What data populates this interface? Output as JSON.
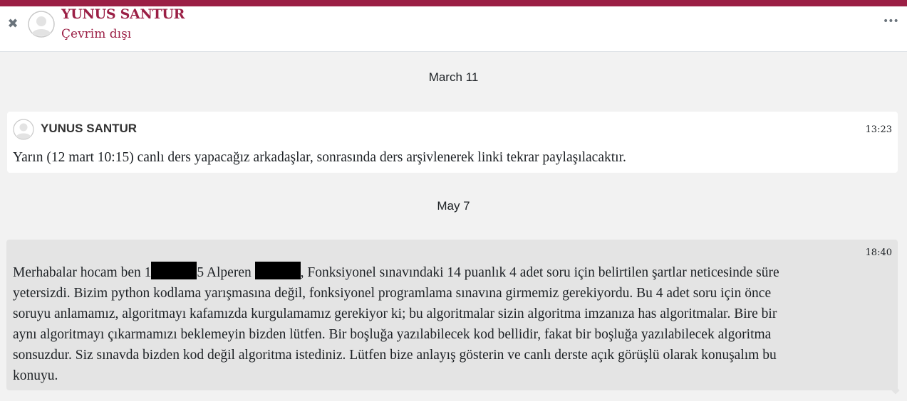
{
  "header": {
    "close_icon": "close-icon",
    "contact_name": "YUNUS SANTUR",
    "status": "Çevrim dışı",
    "menu_icon": "more-horizontal-icon",
    "accent_color": "#9b1f45"
  },
  "conversation": {
    "dates": [
      "March 11",
      "May 7"
    ],
    "messages": [
      {
        "sender": "YUNUS SANTUR",
        "time": "13:23",
        "text": "Yarın (12 mart 10:15) canlı ders yapacağız arkadaşlar, sonrasında ders arşivlenerek linki tekrar paylaşılacaktır."
      },
      {
        "time": "18:40",
        "line1_a": "Merhabalar hocam ben 1",
        "line1_b": "5 Alperen ",
        "line1_c": ", Fonksiyonel sınavındaki 14 puanlık 4 adet soru için belirtilen şartlar neticesinde süre",
        "lines": [
          "yetersizdi. Bizim python kodlama yarışmasına değil, fonksiyonel programlama sınavına girmemiz gerekiyordu. Bu 4 adet soru için önce",
          "soruyu anlamamız, algoritmayı kafamızda kurgulamamız gerekiyor ki; bu algoritmalar sizin algoritma imzanıza has algoritmalar. Bire bir",
          "aynı algoritmayı çıkarmamızı beklemeyin bizden lütfen. Bir boşluğa yazılabilecek kod bellidir, fakat bir boşluğa yazılabilecek algoritma",
          "sonsuzdur. Siz sınavda bizden kod değil algoritma istediniz. Lütfen bize anlayış gösterin ve canlı derste açık görüşlü olarak konuşalım bu",
          "konuyu."
        ]
      }
    ]
  }
}
